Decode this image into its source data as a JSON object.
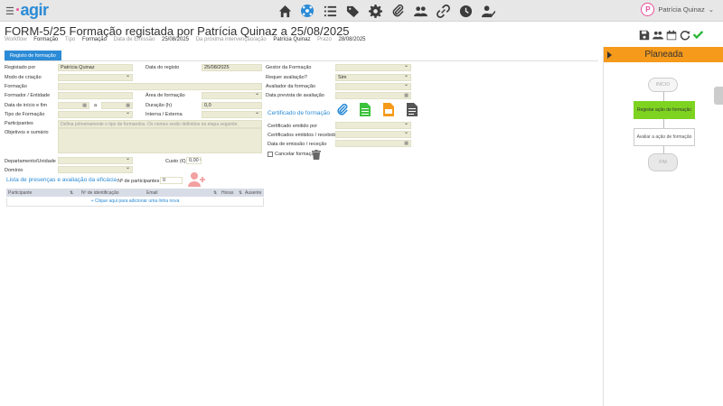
{
  "header": {
    "logo": "agir",
    "user_name": "Patrícia Quinaz",
    "user_initial": "P",
    "icons": [
      "home-icon",
      "network-icon",
      "list-icon",
      "tags-icon",
      "gear-icon",
      "paperclip-icon",
      "users-icon",
      "link-icon",
      "clock-icon",
      "user-check-icon"
    ]
  },
  "page": {
    "title": "FORM-5/25 Formação registada por Patrícia Quinaz a 25/08/2025",
    "meta": [
      {
        "label": "Workflow",
        "value": "Formação"
      },
      {
        "label": "Tipo",
        "value": "Formação"
      },
      {
        "label": "Data de Emissão",
        "value": "25/08/2025"
      },
      {
        "label": "Da próxima intervenção/ação",
        "value": "Patrícia Quinaz"
      },
      {
        "label": "Prazo",
        "value": "28/08/2025"
      }
    ]
  },
  "tab": {
    "label": "Registo de formação"
  },
  "form": {
    "registado_por": {
      "label": "Registado por",
      "value": "Patrícia Quinaz"
    },
    "data_registo": {
      "label": "Data do registo",
      "value": "25/08/2025"
    },
    "gestor": {
      "label": "Gestor da Formação",
      "value": ""
    },
    "modo_criacao": {
      "label": "Modo de criação",
      "value": ""
    },
    "requer_avaliacao": {
      "label": "Requer avaliação?",
      "value": "Sim"
    },
    "formacao": {
      "label": "Formação",
      "value": ""
    },
    "avaliador": {
      "label": "Avaliador da formação",
      "value": ""
    },
    "formador": {
      "label": "Formador / Entidade",
      "value": ""
    },
    "area": {
      "label": "Área de formação",
      "value": ""
    },
    "data_prevista": {
      "label": "Data prevista de avaliação",
      "value": ""
    },
    "data_inicio_fim": {
      "label": "Data de início e fim",
      "sep": "a"
    },
    "duracao": {
      "label": "Duração (h)",
      "value": "0,0"
    },
    "tipo": {
      "label": "Tipo de Formação",
      "value": ""
    },
    "interna_externa": {
      "label": "Interna / Externa",
      "value": ""
    },
    "participantes": {
      "label": "Participantes",
      "placeholder": "Defina primeiramente o tipo de formandos. Os nomes serão definidos na etapa seguinte."
    },
    "objetivos": {
      "label": "Objetivos e sumário"
    },
    "departamento": {
      "label": "Departamento/Unidade",
      "value": ""
    },
    "custo": {
      "label": "Custo (€)",
      "value": "0,00 €"
    },
    "dominio": {
      "label": "Domínio",
      "value": ""
    },
    "certificado_heading": "Certificado de formação",
    "certificado_emitido": {
      "label": "Certificado emitido por",
      "value": ""
    },
    "certificados_emitidos": {
      "label": "Certificados emitidos / recebidos?",
      "value": ""
    },
    "data_emissao": {
      "label": "Data de emissão / receção",
      "value": ""
    },
    "cancelar": {
      "label": "Cancelar formação"
    }
  },
  "presencas": {
    "heading": "Lista de presenças e avaliação da eficácia",
    "n_participantes_label": "Nº de participantes",
    "n_participantes": "0",
    "columns": [
      "Participante",
      "Nº de identificação",
      "Email",
      "Horas",
      "Ausente"
    ],
    "add_row": "+ Clique aqui para adicionar uma linha nova"
  },
  "workflow": {
    "state": "Planeada",
    "nodes": [
      "INÍCIO",
      "Registar ação de formação",
      "Avaliar a ação de formação",
      "FIM"
    ],
    "colors": {
      "active": "#7ed321",
      "state": "#f59a1b"
    }
  }
}
